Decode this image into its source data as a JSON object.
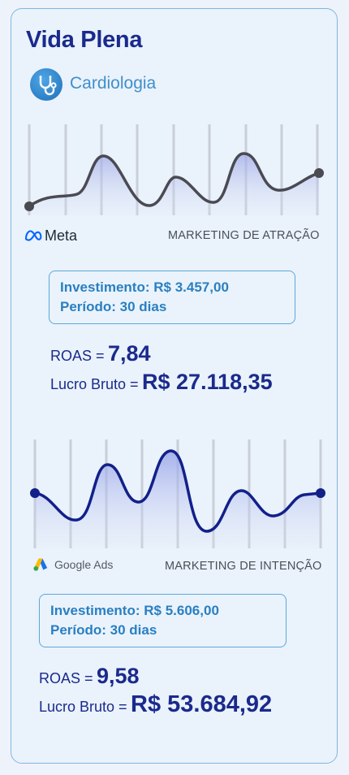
{
  "clinic": {
    "name": "Vida Plena",
    "specialty": "Cardiologia",
    "specialty_icon": "stethoscope-icon"
  },
  "sections": [
    {
      "brand": "Meta",
      "brand_icon": "meta-logo-icon",
      "label": "MARKETING DE ATRAÇÃO",
      "investment_label": "Investimento:",
      "investment_value": "R$ 3.457,00",
      "period": "Período: 30 dias",
      "roas_label": "ROAS =",
      "roas_value": "7,84",
      "profit_label": "Lucro Bruto =",
      "profit_value": "R$ 27.118,35",
      "line_color": "#4a4a52"
    },
    {
      "brand": "Google Ads",
      "brand_icon": "google-ads-logo-icon",
      "label": "MARKETING DE INTENÇÃO",
      "investment_label": "Investimento:",
      "investment_value": "R$ 5.606,00",
      "period": "Período: 30 dias",
      "roas_label": "ROAS =",
      "roas_value": "9,58",
      "profit_label": "Lucro Bruto =",
      "profit_value": "R$ 53.684,92",
      "line_color": "#12208a"
    }
  ],
  "colors": {
    "title": "#1a2a8c",
    "accent": "#2a7fc1",
    "border": "#7fb7df"
  }
}
